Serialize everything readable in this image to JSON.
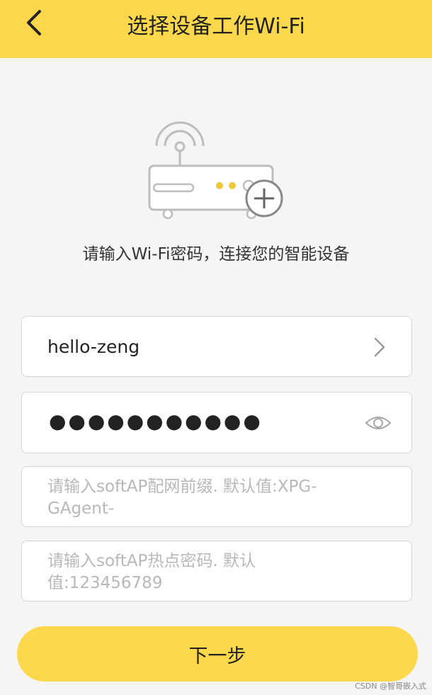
{
  "header": {
    "title": "选择设备工作Wi-Fi",
    "back_icon": "chevron-left-icon"
  },
  "illustration": {
    "icon": "router-add-icon"
  },
  "prompt": "请输入Wi-Fi密码，连接您的智能设备",
  "form": {
    "ssid_value": "hello-zeng",
    "ssid_icon": "chevron-right-icon",
    "password_mask": "●●●●●●●●●●●",
    "password_icon": "eye-icon",
    "prefix_placeholder": "请输入softAP配网前缀. 默认值:XPG-GAgent-",
    "hotspot_placeholder": "请输入softAP热点密码. 默认值:123456789"
  },
  "next_button": "下一步",
  "watermark": "CSDN @智哥嵌入式",
  "colors": {
    "accent": "#fdd84d",
    "background": "#f5f5f5",
    "placeholder_text": "#b8b8b8",
    "router_dot": "#f0c93a"
  }
}
